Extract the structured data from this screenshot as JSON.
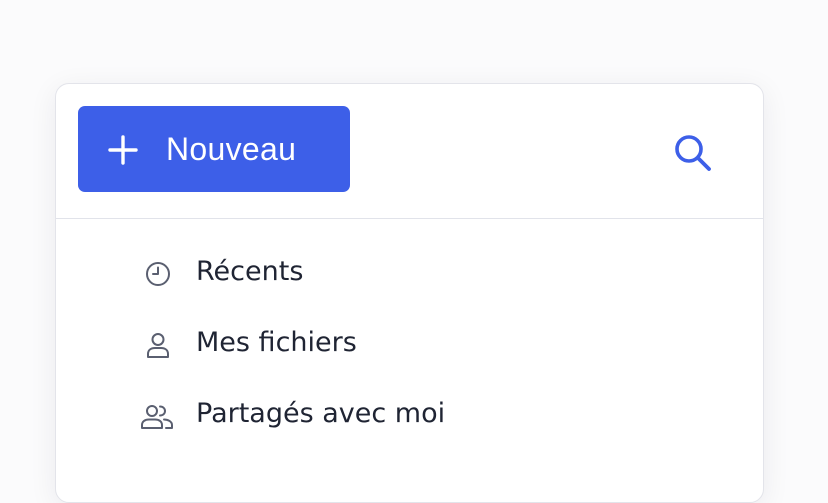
{
  "colors": {
    "accent": "#3d5fe8",
    "text": "#1f2433",
    "icon_muted": "#5a5f70"
  },
  "toolbar": {
    "new_label": "Nouveau",
    "new_icon": "plus-icon",
    "search_icon": "search-icon"
  },
  "nav": {
    "items": [
      {
        "label": "Récents",
        "icon": "clock-icon"
      },
      {
        "label": "Mes fichiers",
        "icon": "user-icon"
      },
      {
        "label": "Partagés avec moi",
        "icon": "users-icon"
      }
    ]
  }
}
